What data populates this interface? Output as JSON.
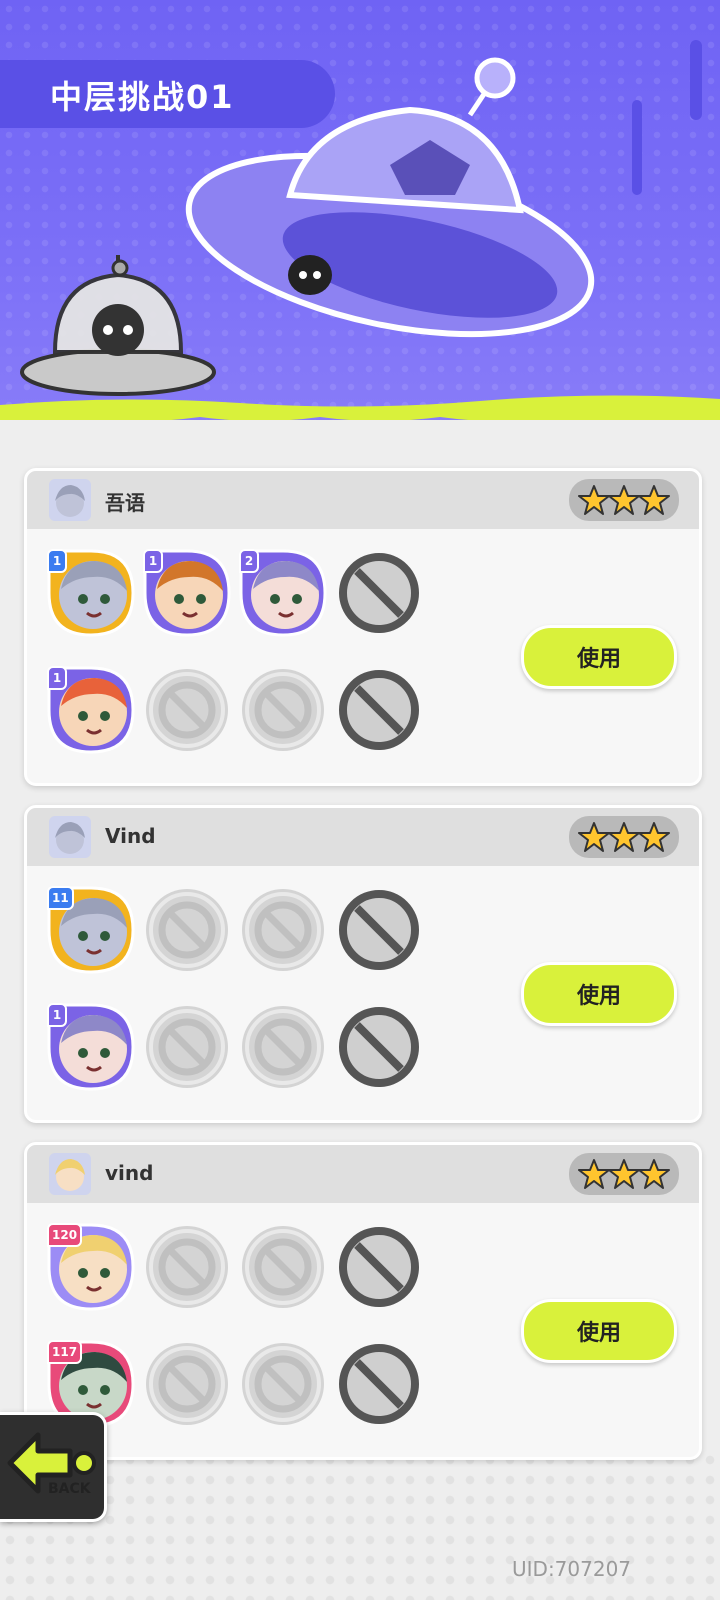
{
  "stage": {
    "title": "中层挑战01"
  },
  "teams": [
    {
      "owner": "吾语",
      "stars": 3,
      "use_label": "使用",
      "rows": [
        [
          {
            "type": "hero",
            "level": "1",
            "frame": "#f2b31e",
            "skin": "#bfc3d8",
            "hair": "#9aa0b8"
          },
          {
            "type": "hero",
            "level": "1",
            "frame": "#7b63e6",
            "skin": "#f7d6b8",
            "hair": "#d2762a"
          },
          {
            "type": "hero",
            "level": "2",
            "frame": "#7b63e6",
            "skin": "#f4ddd8",
            "hair": "#8e88c8"
          },
          {
            "type": "blocked"
          }
        ],
        [
          {
            "type": "hero",
            "level": "1",
            "frame": "#7b63e6",
            "skin": "#f7d6b8",
            "hair": "#e8623a"
          },
          {
            "type": "empty"
          },
          {
            "type": "empty"
          },
          {
            "type": "blocked"
          }
        ]
      ]
    },
    {
      "owner": "Vind",
      "stars": 3,
      "use_label": "使用",
      "rows": [
        [
          {
            "type": "hero",
            "level": "11",
            "frame": "#f2b31e",
            "skin": "#bfc3d8",
            "hair": "#9aa0b8"
          },
          {
            "type": "empty"
          },
          {
            "type": "empty"
          },
          {
            "type": "blocked"
          }
        ],
        [
          {
            "type": "hero",
            "level": "1",
            "frame": "#7b63e6",
            "skin": "#f4ddd8",
            "hair": "#8e88c8"
          },
          {
            "type": "empty"
          },
          {
            "type": "empty"
          },
          {
            "type": "blocked"
          }
        ]
      ]
    },
    {
      "owner": "vind",
      "stars": 3,
      "use_label": "使用",
      "rows": [
        [
          {
            "type": "hero",
            "level": "120",
            "frame": "#9c8cf5",
            "skin": "#f7dfc4",
            "hair": "#f0d070"
          },
          {
            "type": "empty"
          },
          {
            "type": "empty"
          },
          {
            "type": "blocked"
          }
        ],
        [
          {
            "type": "hero",
            "level": "117",
            "frame": "#e84a7a",
            "skin": "#c8d8c8",
            "hair": "#2f4a40"
          },
          {
            "type": "empty"
          },
          {
            "type": "empty"
          },
          {
            "type": "blocked"
          }
        ]
      ]
    }
  ],
  "back": {
    "label": "BACK"
  },
  "footer": {
    "uid": "UID:707207"
  },
  "colors": {
    "header": "#7b6ff7",
    "slime": "#d9f13b",
    "button": "#d9f13b"
  }
}
